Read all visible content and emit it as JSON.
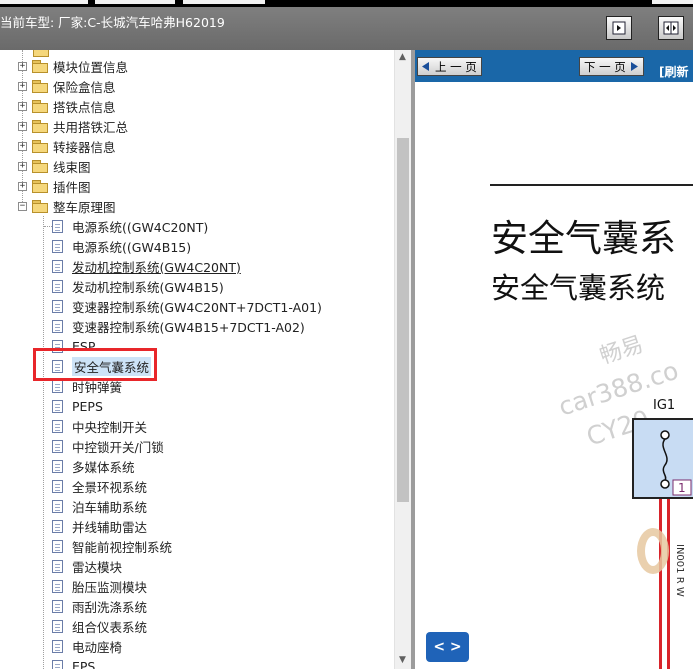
{
  "header": {
    "vehicle_text": "当前车型:  厂家:C-长城汽车哈弗H62019"
  },
  "tree": {
    "folders": [
      {
        "label": "模块位置信息",
        "expander": "+"
      },
      {
        "label": "保险盒信息",
        "expander": "+"
      },
      {
        "label": "搭铁点信息",
        "expander": "+"
      },
      {
        "label": "共用搭铁汇总",
        "expander": "+"
      },
      {
        "label": "转接器信息",
        "expander": "+"
      },
      {
        "label": "线束图",
        "expander": "+"
      },
      {
        "label": "插件图",
        "expander": "+"
      },
      {
        "label": "整车原理图",
        "expander": "−"
      }
    ],
    "documents": [
      "电源系统((GW4C20NT)",
      "电源系统((GW4B15)",
      "发动机控制系统(GW4C20NT)",
      "发动机控制系统(GW4B15)",
      "变速器控制系统(GW4C20NT+7DCT1-A01)",
      "变速器控制系统(GW4B15+7DCT1-A02)",
      "ESP",
      "安全气囊系统",
      "时钟弹簧",
      "PEPS",
      "中央控制开关",
      "中控锁开关/门锁",
      "多媒体系统",
      "全景环视系统",
      "泊车辅助系统",
      "并线辅助雷达",
      "智能前视控制系统",
      "雷达模块",
      "胎压监测模块",
      "雨刮洗涤系统",
      "组合仪表系统",
      "电动座椅",
      "EPS"
    ],
    "selected_index": 7
  },
  "viewer": {
    "prev_label": "上 一 页",
    "next_label": "下 一 页",
    "refresh_label": "[刷新",
    "title": "安全气囊系",
    "subtitle": "安全气囊系统",
    "watermark_1": "畅易",
    "watermark_2": "car388.co",
    "watermark_3": "CY20",
    "fuse_label": "IG1",
    "pin_number": "1",
    "wire_label": "IN001 R W",
    "nav_button_label": "< >"
  },
  "colors": {
    "title_bar": "#6f6f6f",
    "viewer_toolbar": "#1a67a8",
    "selection_highlight": "#e8262a",
    "fuse_box_fill": "#c8dcf3",
    "wire": "#d8242b"
  }
}
